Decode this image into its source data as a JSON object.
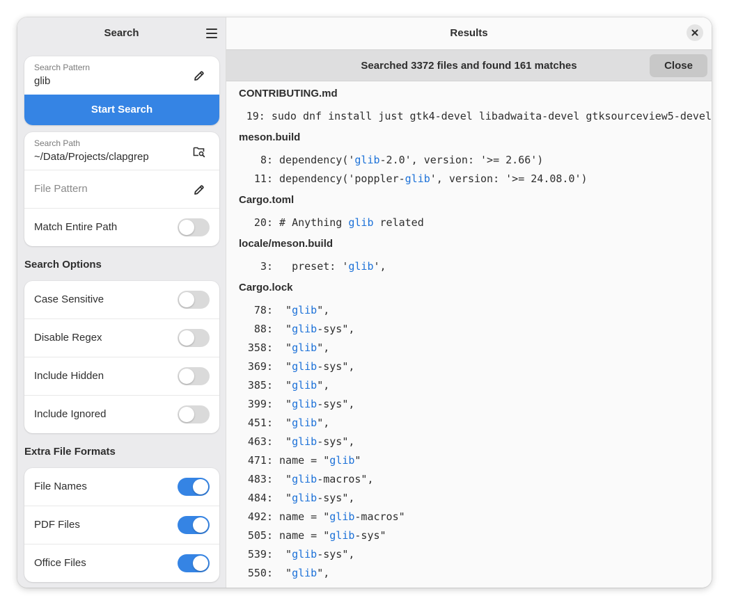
{
  "sidebar": {
    "title": "Search",
    "search_pattern": {
      "caption": "Search Pattern",
      "value": "glib"
    },
    "start_button": "Start Search",
    "search_path": {
      "caption": "Search Path",
      "value": "~/Data/Projects/clapgrep"
    },
    "file_pattern": {
      "placeholder": "File Pattern"
    },
    "match_entire_path": {
      "label": "Match Entire Path",
      "enabled": false
    },
    "options_title": "Search Options",
    "options": [
      {
        "label": "Case Sensitive",
        "enabled": false
      },
      {
        "label": "Disable Regex",
        "enabled": false
      },
      {
        "label": "Include Hidden",
        "enabled": false
      },
      {
        "label": "Include Ignored",
        "enabled": false
      }
    ],
    "formats_title": "Extra File Formats",
    "formats": [
      {
        "label": "File Names",
        "enabled": true
      },
      {
        "label": "PDF Files",
        "enabled": true
      },
      {
        "label": "Office Files",
        "enabled": true
      }
    ]
  },
  "results": {
    "title": "Results",
    "banner": "Searched 3372 files and found 161 matches",
    "banner_button": "Close",
    "files": [
      {
        "name": "CONTRIBUTING.md",
        "lines": [
          {
            "n": "19",
            "parts": [
              {
                "t": " sudo dnf install just gtk4-devel libadwaita-devel gtksourceview5-devel"
              }
            ]
          }
        ]
      },
      {
        "name": "meson.build",
        "lines": [
          {
            "n": "8",
            "parts": [
              {
                "t": " dependency('"
              },
              {
                "t": "glib",
                "hl": true
              },
              {
                "t": "-2.0', version: '>= 2.66')"
              }
            ]
          },
          {
            "n": "11",
            "parts": [
              {
                "t": " dependency('poppler-"
              },
              {
                "t": "glib",
                "hl": true
              },
              {
                "t": "', version: '>= 24.08.0')"
              }
            ]
          }
        ]
      },
      {
        "name": "Cargo.toml",
        "lines": [
          {
            "n": "20",
            "parts": [
              {
                "t": " # Anything "
              },
              {
                "t": "glib",
                "hl": true
              },
              {
                "t": " related"
              }
            ]
          }
        ]
      },
      {
        "name": "locale/meson.build",
        "lines": [
          {
            "n": "3",
            "parts": [
              {
                "t": "   preset: '"
              },
              {
                "t": "glib",
                "hl": true
              },
              {
                "t": "',"
              }
            ]
          }
        ]
      },
      {
        "name": "Cargo.lock",
        "lines": [
          {
            "n": "78",
            "parts": [
              {
                "t": "  \""
              },
              {
                "t": "glib",
                "hl": true
              },
              {
                "t": "\","
              }
            ]
          },
          {
            "n": "88",
            "parts": [
              {
                "t": "  \""
              },
              {
                "t": "glib",
                "hl": true
              },
              {
                "t": "-sys\","
              }
            ]
          },
          {
            "n": "358",
            "parts": [
              {
                "t": "  \""
              },
              {
                "t": "glib",
                "hl": true
              },
              {
                "t": "\","
              }
            ]
          },
          {
            "n": "369",
            "parts": [
              {
                "t": "  \""
              },
              {
                "t": "glib",
                "hl": true
              },
              {
                "t": "-sys\","
              }
            ]
          },
          {
            "n": "385",
            "parts": [
              {
                "t": "  \""
              },
              {
                "t": "glib",
                "hl": true
              },
              {
                "t": "\","
              }
            ]
          },
          {
            "n": "399",
            "parts": [
              {
                "t": "  \""
              },
              {
                "t": "glib",
                "hl": true
              },
              {
                "t": "-sys\","
              }
            ]
          },
          {
            "n": "451",
            "parts": [
              {
                "t": "  \""
              },
              {
                "t": "glib",
                "hl": true
              },
              {
                "t": "\","
              }
            ]
          },
          {
            "n": "463",
            "parts": [
              {
                "t": "  \""
              },
              {
                "t": "glib",
                "hl": true
              },
              {
                "t": "-sys\","
              }
            ]
          },
          {
            "n": "471",
            "parts": [
              {
                "t": " name = \""
              },
              {
                "t": "glib",
                "hl": true
              },
              {
                "t": "\""
              }
            ]
          },
          {
            "n": "483",
            "parts": [
              {
                "t": "  \""
              },
              {
                "t": "glib",
                "hl": true
              },
              {
                "t": "-macros\","
              }
            ]
          },
          {
            "n": "484",
            "parts": [
              {
                "t": "  \""
              },
              {
                "t": "glib",
                "hl": true
              },
              {
                "t": "-sys\","
              }
            ]
          },
          {
            "n": "492",
            "parts": [
              {
                "t": " name = \""
              },
              {
                "t": "glib",
                "hl": true
              },
              {
                "t": "-macros\""
              }
            ]
          },
          {
            "n": "505",
            "parts": [
              {
                "t": " name = \""
              },
              {
                "t": "glib",
                "hl": true
              },
              {
                "t": "-sys\""
              }
            ]
          },
          {
            "n": "539",
            "parts": [
              {
                "t": "  \""
              },
              {
                "t": "glib",
                "hl": true
              },
              {
                "t": "-sys\","
              }
            ]
          },
          {
            "n": "550",
            "parts": [
              {
                "t": "  \""
              },
              {
                "t": "glib",
                "hl": true
              },
              {
                "t": "\","
              }
            ]
          }
        ]
      }
    ]
  },
  "colors": {
    "accent": "#3584e4",
    "highlight": "#1c71d8",
    "sidebar_bg": "#ebebed",
    "banner_bg": "#dededf"
  }
}
